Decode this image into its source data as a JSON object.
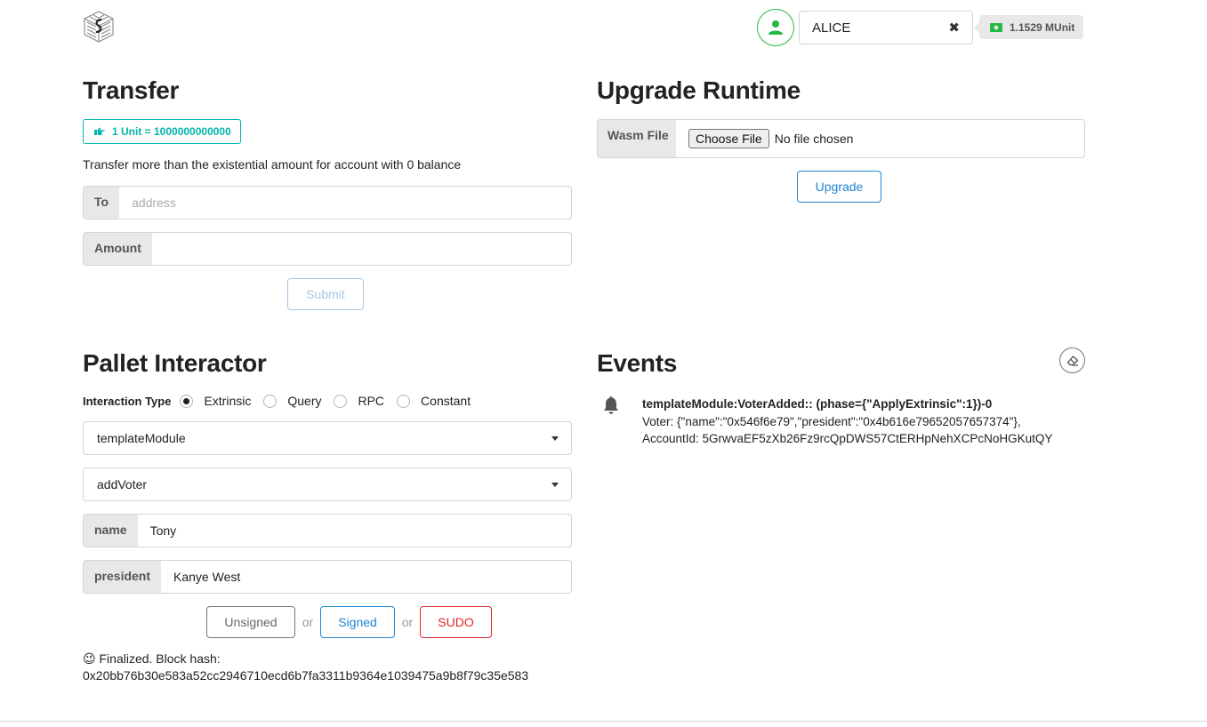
{
  "header": {
    "account_name": "ALICE",
    "clear_symbol": "✖",
    "balance": "1.1529 MUnit"
  },
  "transfer": {
    "title": "Transfer",
    "unit_label": "1 Unit = 1000000000000",
    "hint": "Transfer more than the existential amount for account with 0 balance",
    "to_label": "To",
    "to_placeholder": "address",
    "amount_label": "Amount",
    "amount_value": "",
    "submit_label": "Submit"
  },
  "upgrade": {
    "title": "Upgrade Runtime",
    "wasm_label": "Wasm File",
    "choose_file_label": "Choose File",
    "no_file_text": "No file chosen",
    "upgrade_label": "Upgrade"
  },
  "pallet": {
    "title": "Pallet Interactor",
    "interaction_type_label": "Interaction Type",
    "options": [
      {
        "label": "Extrinsic",
        "selected": true
      },
      {
        "label": "Query",
        "selected": false
      },
      {
        "label": "RPC",
        "selected": false
      },
      {
        "label": "Constant",
        "selected": false
      }
    ],
    "pallet_value": "templateModule",
    "callable_value": "addVoter",
    "params": [
      {
        "label": "name",
        "value": "Tony"
      },
      {
        "label": "president",
        "value": "Kanye West"
      }
    ],
    "buttons": {
      "unsigned": "Unsigned",
      "signed": "Signed",
      "sudo": "SUDO",
      "or": "or"
    },
    "status_emoji": "😉",
    "status_line1": "Finalized. Block hash:",
    "status_line2": "0x20bb76b30e583a52cc2946710ecd6b7fa3311b9364e1039475a9b8f79c35e583"
  },
  "events": {
    "title": "Events",
    "items": [
      {
        "title": "templateModule:VoterAdded:: (phase={\"ApplyExtrinsic\":1})-0",
        "line1": "Voter: {\"name\":\"0x546f6e79\",\"president\":\"0x4b616e79652057657374\"},",
        "line2": "AccountId: 5GrwvaEF5zXb26Fz9rcQpDWS57CtERHpNehXCPcNoHGKutQY"
      }
    ]
  },
  "colors": {
    "teal": "#00b5ad",
    "blue": "#2185d0",
    "red": "#db2828",
    "green": "#21ba45"
  },
  "icons": {
    "logo": "substrate-logo-icon",
    "avatar": "user-icon",
    "balance": "money-bill-icon",
    "unit": "hand-point-right-icon",
    "erase": "eraser-icon",
    "event": "bell-icon"
  }
}
